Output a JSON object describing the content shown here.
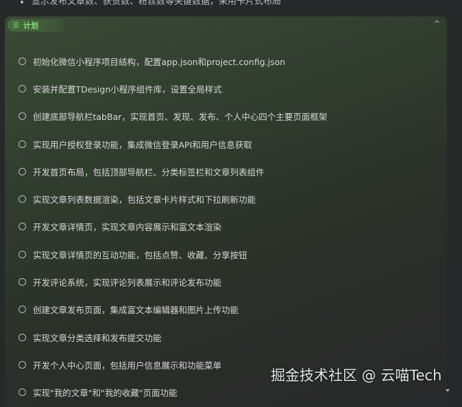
{
  "top_line": "显示发布文章数、获赞数、粉丝数等关键数据，采用卡片式布局",
  "plan": {
    "title": "计划",
    "collapse_icon": "chevron-up-icon",
    "items": [
      "初始化微信小程序项目结构，配置app.json和project.config.json",
      "安装并配置TDesign小程序组件库，设置全局样式",
      "创建底部导航栏tabBar，实现首页、发现、发布、个人中心四个主要页面框架",
      "实现用户授权登录功能，集成微信登录API和用户信息获取",
      "开发首页布局，包括顶部导航栏、分类标签栏和文章列表组件",
      "实现文章列表数据渲染，包括文章卡片样式和下拉刷新功能",
      "开发文章详情页，实现文章内容展示和富文本渲染",
      "实现文章详情页的互动功能，包括点赞、收藏、分享按钮",
      "开发评论系统，实现评论列表展示和评论发布功能",
      "创建文章发布页面，集成富文本编辑器和图片上传功能",
      "实现文章分类选择和发布提交功能",
      "开发个人中心页面，包括用户信息展示和功能菜单",
      "实现\"我的文章\"和\"我的收藏\"页面功能"
    ]
  },
  "watermark": "掘金技术社区 @ 云喵Tech"
}
